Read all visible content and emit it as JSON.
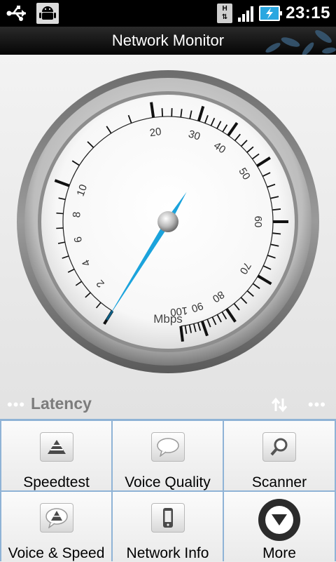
{
  "status_bar": {
    "time": "23:15",
    "network_badge": "H",
    "icons": [
      "usb-icon",
      "android-debug-icon",
      "hspa-data-icon",
      "signal-icon",
      "battery-charging-icon"
    ]
  },
  "app": {
    "title": "Network Monitor"
  },
  "gauge": {
    "unit": "Mbps",
    "labels": [
      "2",
      "4",
      "6",
      "8",
      "10",
      "20",
      "30",
      "40",
      "50",
      "60",
      "70",
      "80",
      "90",
      "100"
    ],
    "needle_value_mbps": 0,
    "accent_color": "#1ba3dc"
  },
  "latency_bar": {
    "label": "Latency",
    "left_dots": "•••",
    "right_dots": "•••"
  },
  "menu": {
    "items": [
      {
        "label": "Speedtest",
        "icon": "speedtest-icon"
      },
      {
        "label": "Voice Quality",
        "icon": "voice-quality-icon"
      },
      {
        "label": "Scanner",
        "icon": "scanner-icon"
      },
      {
        "label": "Voice & Speed",
        "icon": "voice-speed-icon"
      },
      {
        "label": "Network Info",
        "icon": "phone-icon"
      },
      {
        "label": "More",
        "icon": "more-icon"
      }
    ]
  }
}
